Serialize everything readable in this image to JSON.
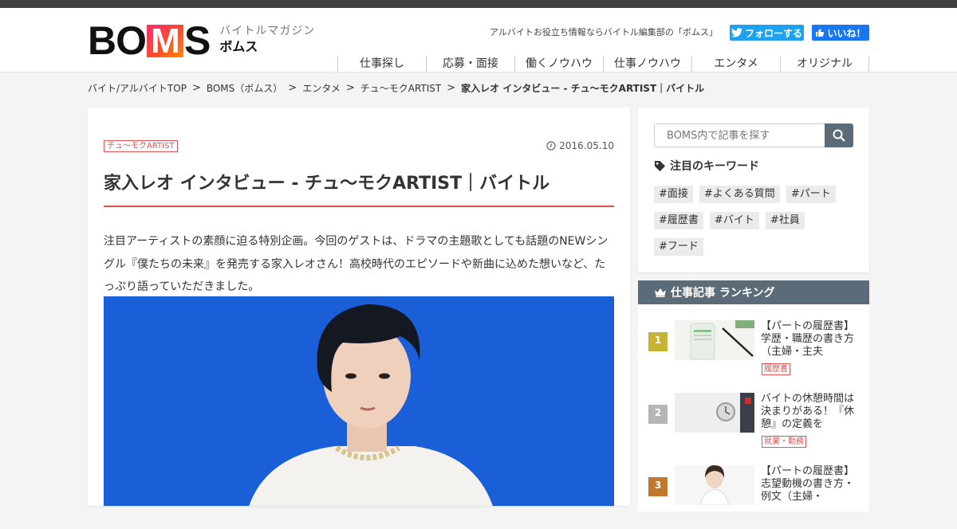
{
  "header": {
    "logo_text_left": "BO",
    "logo_text_m": "M",
    "logo_text_right": "S",
    "logo_sub_line1": "バイトルマガジン",
    "logo_sub_line2": "ボムス",
    "tagline": "アルバイトお役立ち情報ならバイトル編集部の「ボムス」",
    "twitter_label": "フォローする",
    "facebook_label": "いいね！",
    "nav": [
      "仕事探し",
      "応募・面接",
      "働くノウハウ",
      "仕事ノウハウ",
      "エンタメ",
      "オリジナル"
    ]
  },
  "breadcrumb": {
    "items": [
      "バイト/アルバイトTOP",
      "BOMS（ボムス）",
      "エンタメ",
      "チュ～モクARTIST"
    ],
    "separator": ">",
    "current": "家入レオ インタビュー - チュ～モクARTIST｜バイトル"
  },
  "article": {
    "category": "チュ～モクARTIST",
    "date": "2016.05.10",
    "title": "家入レオ インタビュー - チュ～モクARTIST｜バイトル",
    "lead": "注目アーティストの素顔に迫る特別企画。今回のゲストは、ドラマの主題歌としても話題のNEWシングル『僕たちの未来』を発売する家入レオさん！高校時代のエピソードや新曲に込めた想いなど、たっぷり語っていただきました。"
  },
  "sidebar": {
    "search_placeholder": "BOMS内で記事を探す",
    "keywords_heading": "注目のキーワード",
    "keywords": [
      "#面接",
      "#よくある質問",
      "#パート",
      "#履歴書",
      "#バイト",
      "#社員",
      "#フード"
    ]
  },
  "ranking": {
    "heading": "仕事記事 ランキング",
    "items": [
      {
        "rank": "1",
        "title": "【パートの履歴書】学歴・職歴の書き方（主婦・主夫編・・・",
        "tag": "履歴書"
      },
      {
        "rank": "2",
        "title": "バイトの休憩時間は決まりがある！『休憩』の定義を知・・・",
        "tag": "就業・勤務"
      },
      {
        "rank": "3",
        "title": "【パートの履歴書】志望動機の書き方・例文（主婦・主・・・",
        "tag": ""
      }
    ]
  },
  "colors": {
    "accent_red": "#e25252",
    "slate": "#5b6b78",
    "twitter": "#1da1f2",
    "facebook": "#1877f2",
    "photo_bg": "#1a5ed8"
  }
}
